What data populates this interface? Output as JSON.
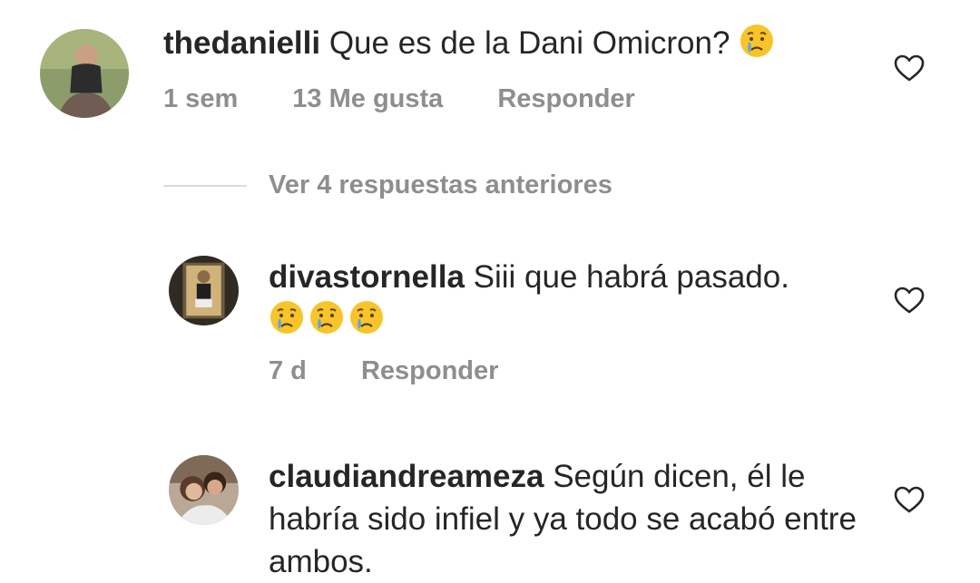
{
  "comments": [
    {
      "username": "thedanielli",
      "text": "Que es de la Dani Omicron?",
      "emoji": "crying-face",
      "time": "1 sem",
      "likes": "13 Me gusta",
      "reply": "Responder"
    },
    {
      "username": "divastornella",
      "text": "Siii que habrá pasado.",
      "emoji": "crying-face",
      "time": "7 d",
      "reply": "Responder"
    },
    {
      "username": "claudiandreameza",
      "text": "Según dicen, él le habría sido infiel y ya todo se acabó entre ambos."
    }
  ],
  "view_previous": "Ver 4 respuestas anteriores",
  "colors": {
    "text": "#262626",
    "muted": "#8e8e8e",
    "divider": "#dbdbdb",
    "emoji": "#f7c52a"
  },
  "icons": [
    "heart-icon",
    "crying-face-emoji"
  ]
}
